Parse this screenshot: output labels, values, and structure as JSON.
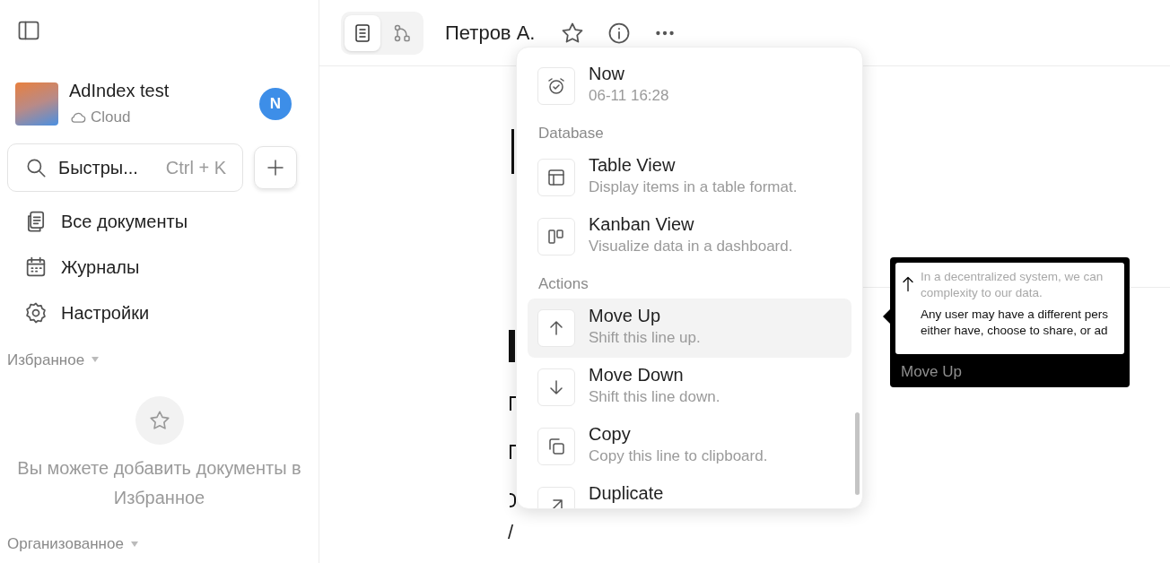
{
  "sidebar": {
    "workspace": {
      "name": "AdIndex test",
      "storage": "Cloud",
      "avatar_letter": "N"
    },
    "search": {
      "placeholder": "Быстры...",
      "shortcut": "Ctrl + K"
    },
    "nav": [
      {
        "label": "Все документы"
      },
      {
        "label": "Журналы"
      },
      {
        "label": "Настройки"
      }
    ],
    "favorites": {
      "title": "Избранное",
      "empty_text": "Вы можете добавить документы в Избранное"
    },
    "organized": {
      "title": "Организованное"
    }
  },
  "header": {
    "modes": [
      {
        "selected": true
      },
      {
        "selected": false
      }
    ],
    "title": "Петров А."
  },
  "document": {
    "paragraphs": [
      "/"
    ]
  },
  "menu": {
    "groups": [
      {
        "items": [
          {
            "title": "Now",
            "subtitle": "06-11 16:28",
            "selected": false
          }
        ]
      },
      {
        "title": "Database",
        "items": [
          {
            "title": "Table View",
            "subtitle": "Display items in a table format.",
            "selected": false
          },
          {
            "title": "Kanban View",
            "subtitle": "Visualize data in a dashboard.",
            "selected": false
          }
        ]
      },
      {
        "title": "Actions",
        "items": [
          {
            "title": "Move Up",
            "subtitle": "Shift this line up.",
            "selected": true
          },
          {
            "title": "Move Down",
            "subtitle": "Shift this line down.",
            "selected": false
          },
          {
            "title": "Copy",
            "subtitle": "Copy this line to clipboard.",
            "selected": false
          },
          {
            "title": "Duplicate",
            "selected": false
          }
        ]
      }
    ]
  },
  "tooltip": {
    "preview_lines": [
      {
        "text": "In a decentralized system, we can",
        "muted": true
      },
      {
        "text": "complexity to our data.",
        "muted": true
      },
      {
        "text": "Any user may have a different pers",
        "muted": false
      },
      {
        "text": "either have, choose to share, or ad",
        "muted": false
      }
    ],
    "label": "Move Up"
  }
}
